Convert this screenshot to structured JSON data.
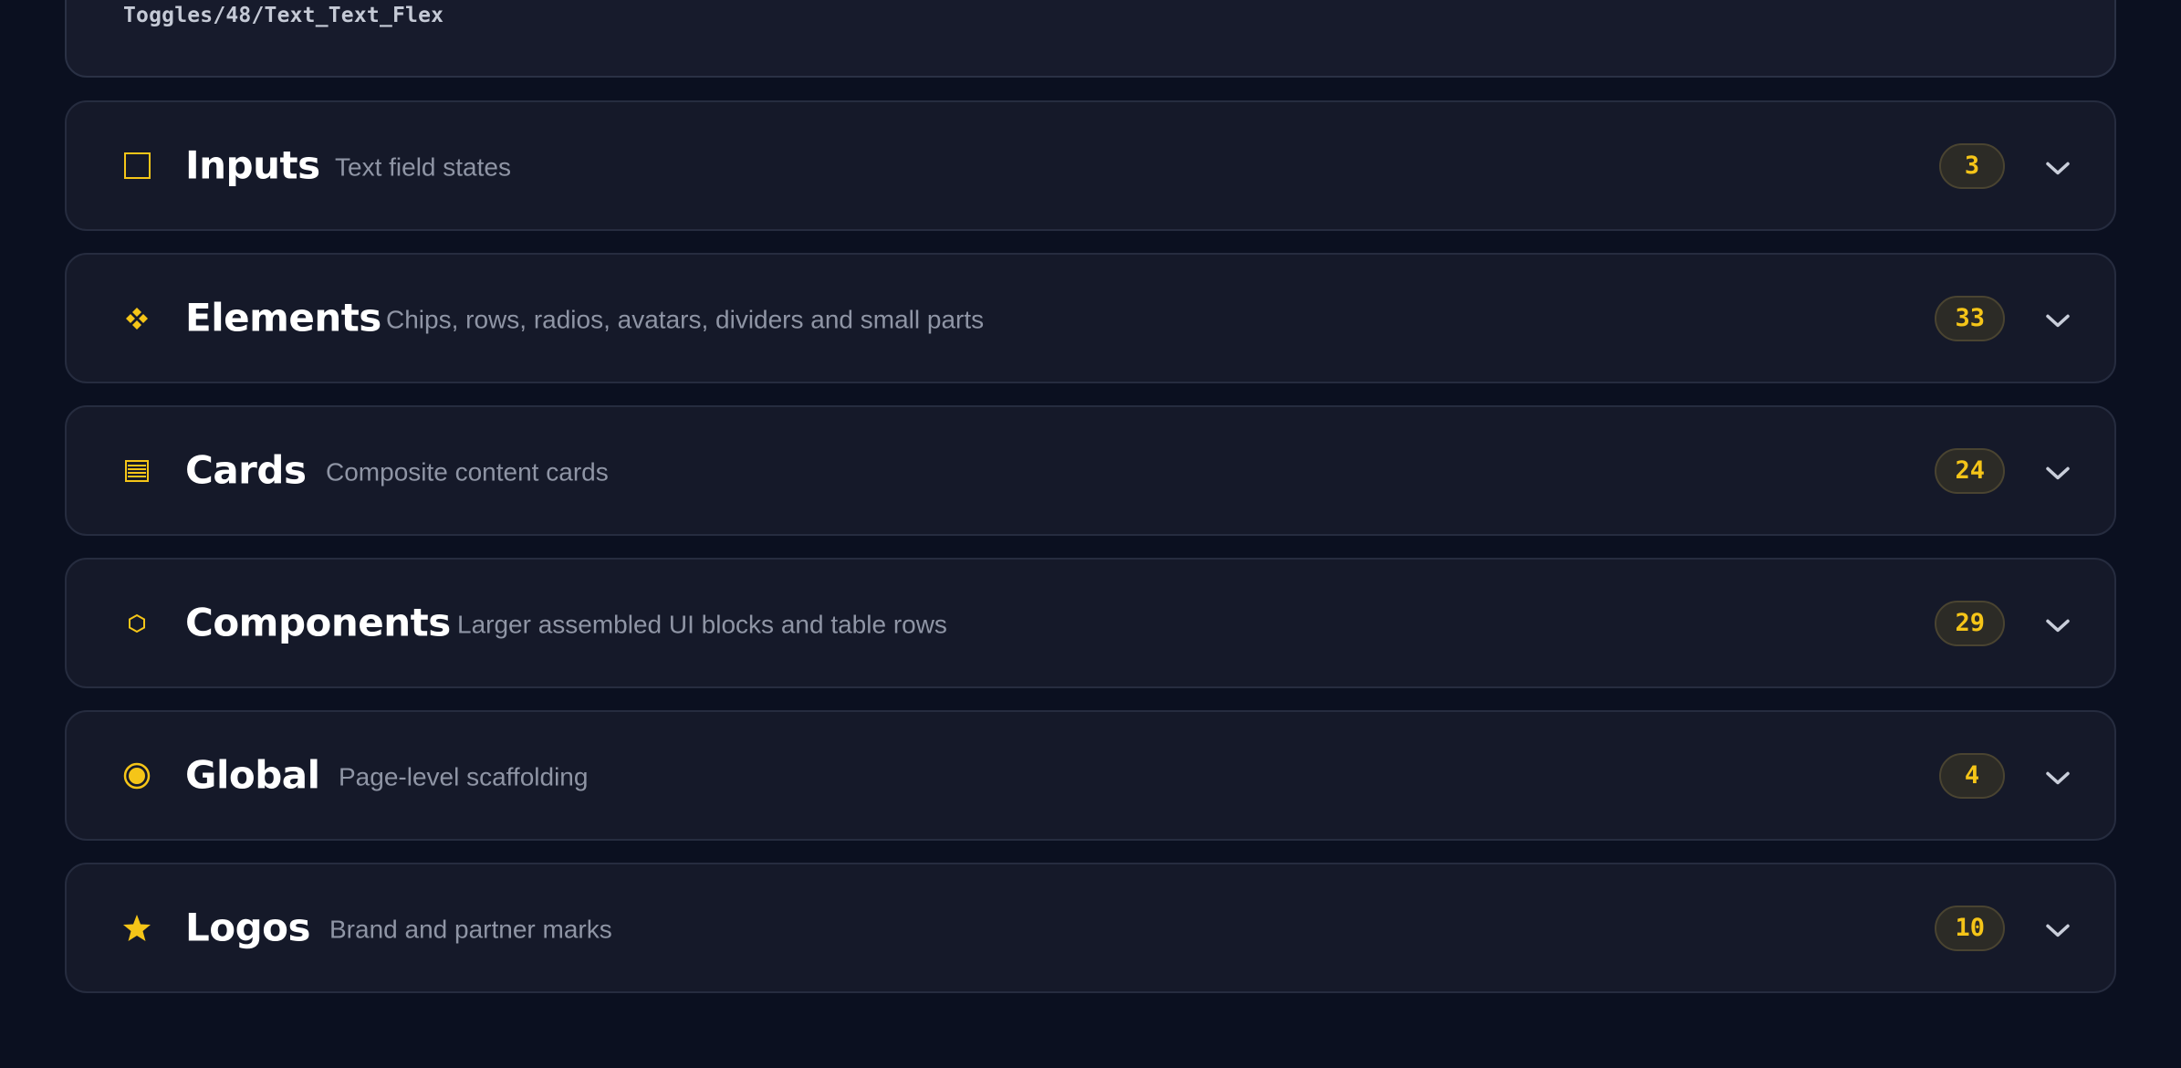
{
  "top_card": {
    "path": "Toggles/48/Text_Text_Flex"
  },
  "sections": [
    {
      "title": "Inputs",
      "subtitle": "Text field states",
      "count": "3",
      "icon": "square-outline-icon"
    },
    {
      "title": "Elements",
      "subtitle": "Chips, rows, radios, avatars, dividers and small parts",
      "count": "33",
      "icon": "four-diamonds-icon"
    },
    {
      "title": "Cards",
      "subtitle": "Composite content cards",
      "count": "24",
      "icon": "card-stack-icon"
    },
    {
      "title": "Components",
      "subtitle": "Larger assembled UI blocks and table rows",
      "count": "29",
      "icon": "hexagon-icon"
    },
    {
      "title": "Global",
      "subtitle": "Page-level scaffolding",
      "count": "4",
      "icon": "radio-circle-icon"
    },
    {
      "title": "Logos",
      "subtitle": "Brand and partner marks",
      "count": "10",
      "icon": "star-icon"
    }
  ],
  "colors": {
    "background": "#0b1020",
    "card": "#151929",
    "accent": "#f5c518",
    "title": "#ffffff",
    "subtitle": "#8f95a5"
  }
}
